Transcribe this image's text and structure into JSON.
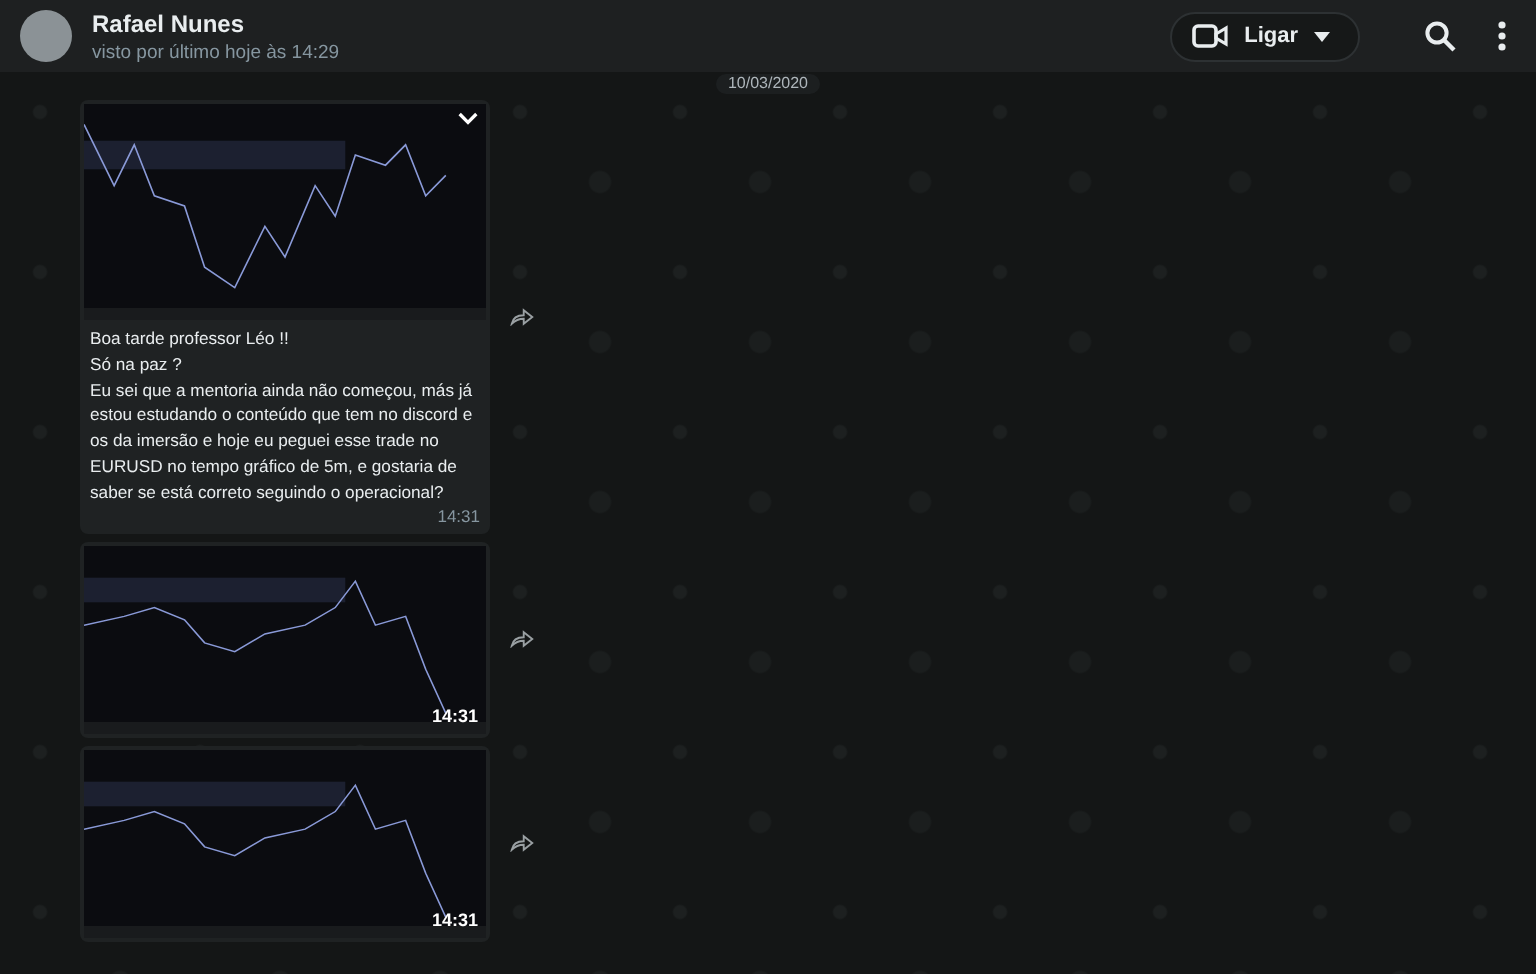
{
  "header": {
    "contact_name": "Rafael Nunes",
    "last_seen": "visto por último hoje às 14:29",
    "call_button": {
      "label": "Ligar"
    }
  },
  "date_chip": "10/03/2020",
  "messages": [
    {
      "kind": "image_caption",
      "caption": "Boa tarde professor Léo !!\nSó na paz ?\nEu sei que a mentoria ainda não começou, más já estou estudando o conteúdo que tem no discord e os da imersão e hoje eu peguei esse trade no EURUSD no tempo gráfico de 5m, e gostaria de saber se está correto seguindo o operacional?",
      "time": "14:31"
    },
    {
      "kind": "image",
      "time": "14:31"
    },
    {
      "kind": "image",
      "time": "14:31"
    }
  ]
}
